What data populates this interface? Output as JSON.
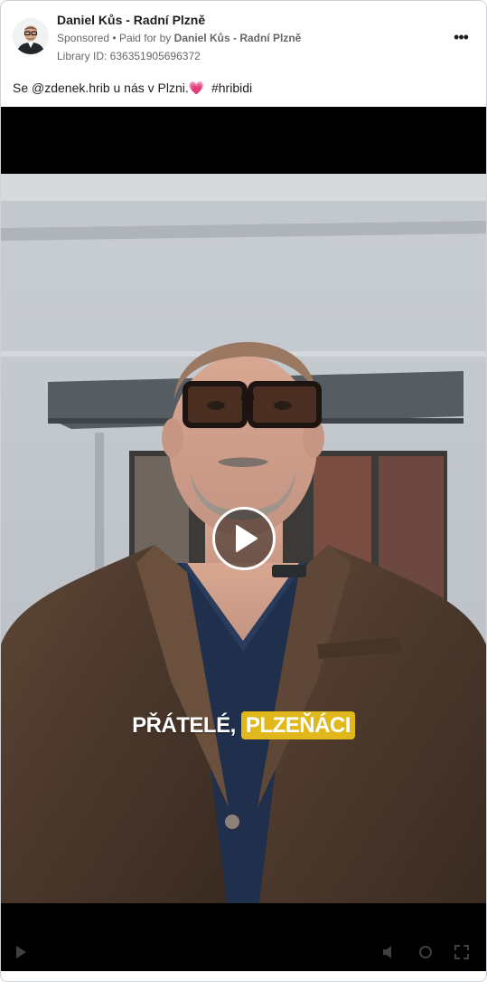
{
  "ad": {
    "page_name": "Daniel Kůs - Radní Plzně",
    "sponsored_label": "Sponsored",
    "separator": "•",
    "paid_for_prefix": "Paid for by",
    "paid_for_name": "Daniel Kůs - Radní Plzně",
    "library_id": "Library ID: 636351905696372",
    "more_icon": "more-horizontal-icon",
    "more_glyph": "•••"
  },
  "post": {
    "caption_text": "Se @zdenek.hrib u nás v Plzni.",
    "caption_heart": "💗",
    "caption_hashtag": "#hribidi"
  },
  "video": {
    "play_icon": "play-icon",
    "subtitle_white": "PŘÁTELÉ,",
    "subtitle_highlight": "PLZEŇÁCI",
    "highlight_color": "#e0b81c"
  }
}
